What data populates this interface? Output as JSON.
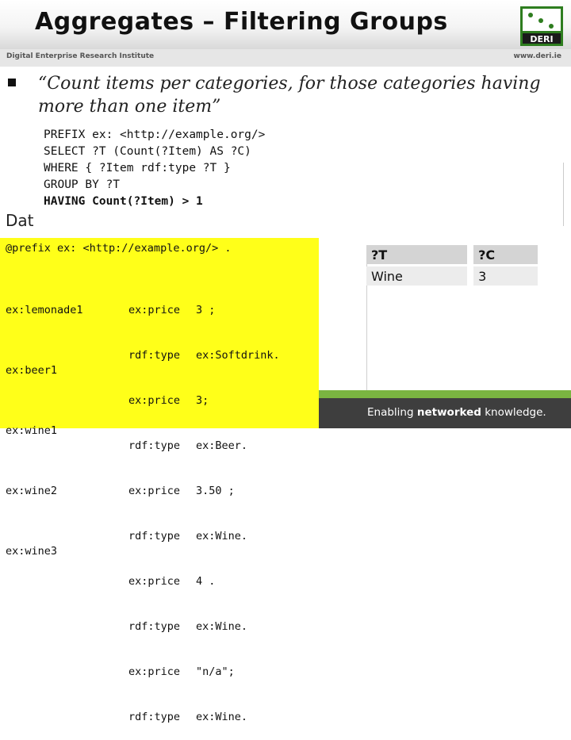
{
  "header": {
    "title": "Aggregates – Filtering Groups",
    "institute": "Digital Enterprise Research Institute",
    "website": "www.deri.ie",
    "logo_text": "DERI"
  },
  "body": {
    "quote": "“Count items per categories, for those categories having more than one item”",
    "query_lines": [
      "PREFIX ex: <http://example.org/>",
      "SELECT ?T (Count(?Item) AS ?C)",
      "WHERE { ?Item rdf:type ?T }",
      "GROUP BY ?T",
      "HAVING Count(?Item) > 1"
    ],
    "data_label": "Dat"
  },
  "data_box": {
    "prefix": "@prefix ex: <http://example.org/> .",
    "subjects": [
      "ex:lemonade1",
      "ex:beer1",
      "ex:wine1",
      "ex:wine2",
      "ex:wine3"
    ],
    "predicates": [
      "ex:price",
      "rdf:type",
      "ex:price",
      "rdf:type",
      "ex:price",
      "rdf:type",
      "ex:price",
      "rdf:type",
      "ex:price",
      "rdf:type"
    ],
    "objects": [
      "3 ;",
      "ex:Softdrink.",
      "3;",
      "ex:Beer.",
      "3.50 ;",
      "ex:Wine.",
      "4 .",
      "ex:Wine.",
      "\"n/a\";",
      "ex:Wine."
    ]
  },
  "result_table": {
    "headers": [
      "?T",
      "?C"
    ],
    "rows": [
      [
        "Wine",
        "3"
      ]
    ]
  },
  "footer": {
    "prefix": "Enabling ",
    "bold": "networked",
    "suffix": " knowledge."
  }
}
